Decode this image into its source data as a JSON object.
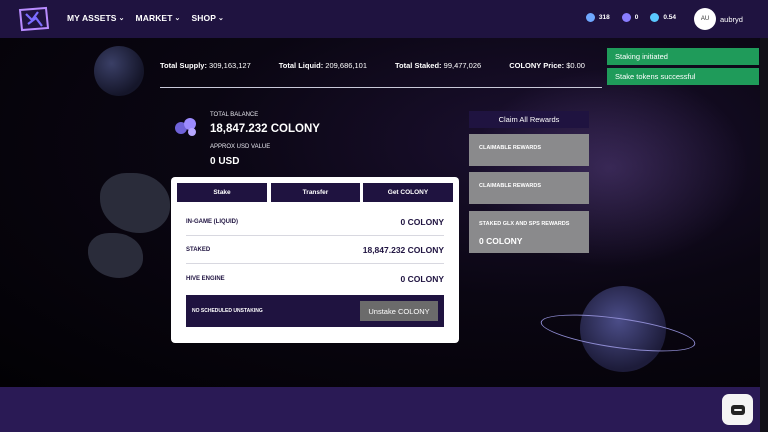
{
  "nav": {
    "menu": [
      {
        "label": "MY ASSETS"
      },
      {
        "label": "MARKET"
      },
      {
        "label": "SHOP"
      }
    ],
    "resources": [
      {
        "icon": "crystal-icon",
        "value": "318",
        "color": "#6fa8ff"
      },
      {
        "icon": "energy-icon",
        "value": "0",
        "color": "#8a7dff"
      },
      {
        "icon": "feather-icon",
        "value": "0.54",
        "color": "#5ac8ff"
      }
    ],
    "avatar_initials": "AU",
    "username": "aubryd"
  },
  "stats": {
    "total_supply_label": "Total Supply:",
    "total_supply": "309,163,127",
    "total_liquid_label": "Total Liquid:",
    "total_liquid": "209,686,101",
    "total_staked_label": "Total Staked:",
    "total_staked": "99,477,026",
    "price_label": "COLONY Price:",
    "price": "$0.00"
  },
  "balance": {
    "label": "TOTAL BALANCE",
    "value": "18,847.232 COLONY",
    "usd_label": "APPROX USD VALUE",
    "usd_value": "0 USD"
  },
  "card": {
    "buttons": {
      "stake": "Stake",
      "transfer": "Transfer",
      "get": "Get COLONY"
    },
    "rows": [
      {
        "label": "IN-GAME (LIQUID)",
        "value": "0 COLONY"
      },
      {
        "label": "STAKED",
        "value": "18,847.232 COLONY"
      },
      {
        "label": "HIVE ENGINE",
        "value": "0 COLONY"
      }
    ],
    "no_unstaking": "NO SCHEDULED UNSTAKING",
    "unstake_button": "Unstake COLONY"
  },
  "rewards": {
    "claim_all": "Claim All Rewards",
    "boxes": [
      {
        "title": "CLAIMABLE REWARDS",
        "value": ""
      },
      {
        "title": "CLAIMABLE REWARDS",
        "value": ""
      },
      {
        "title": "STAKED GLX AND SPS REWARDS",
        "value": "0 COLONY"
      }
    ]
  },
  "toasts": [
    "Staking initiated",
    "Stake tokens successful"
  ],
  "colors": {
    "nav": "#1f1340",
    "toast": "#1f9b5a",
    "reward_box": "#8a8a8c"
  }
}
